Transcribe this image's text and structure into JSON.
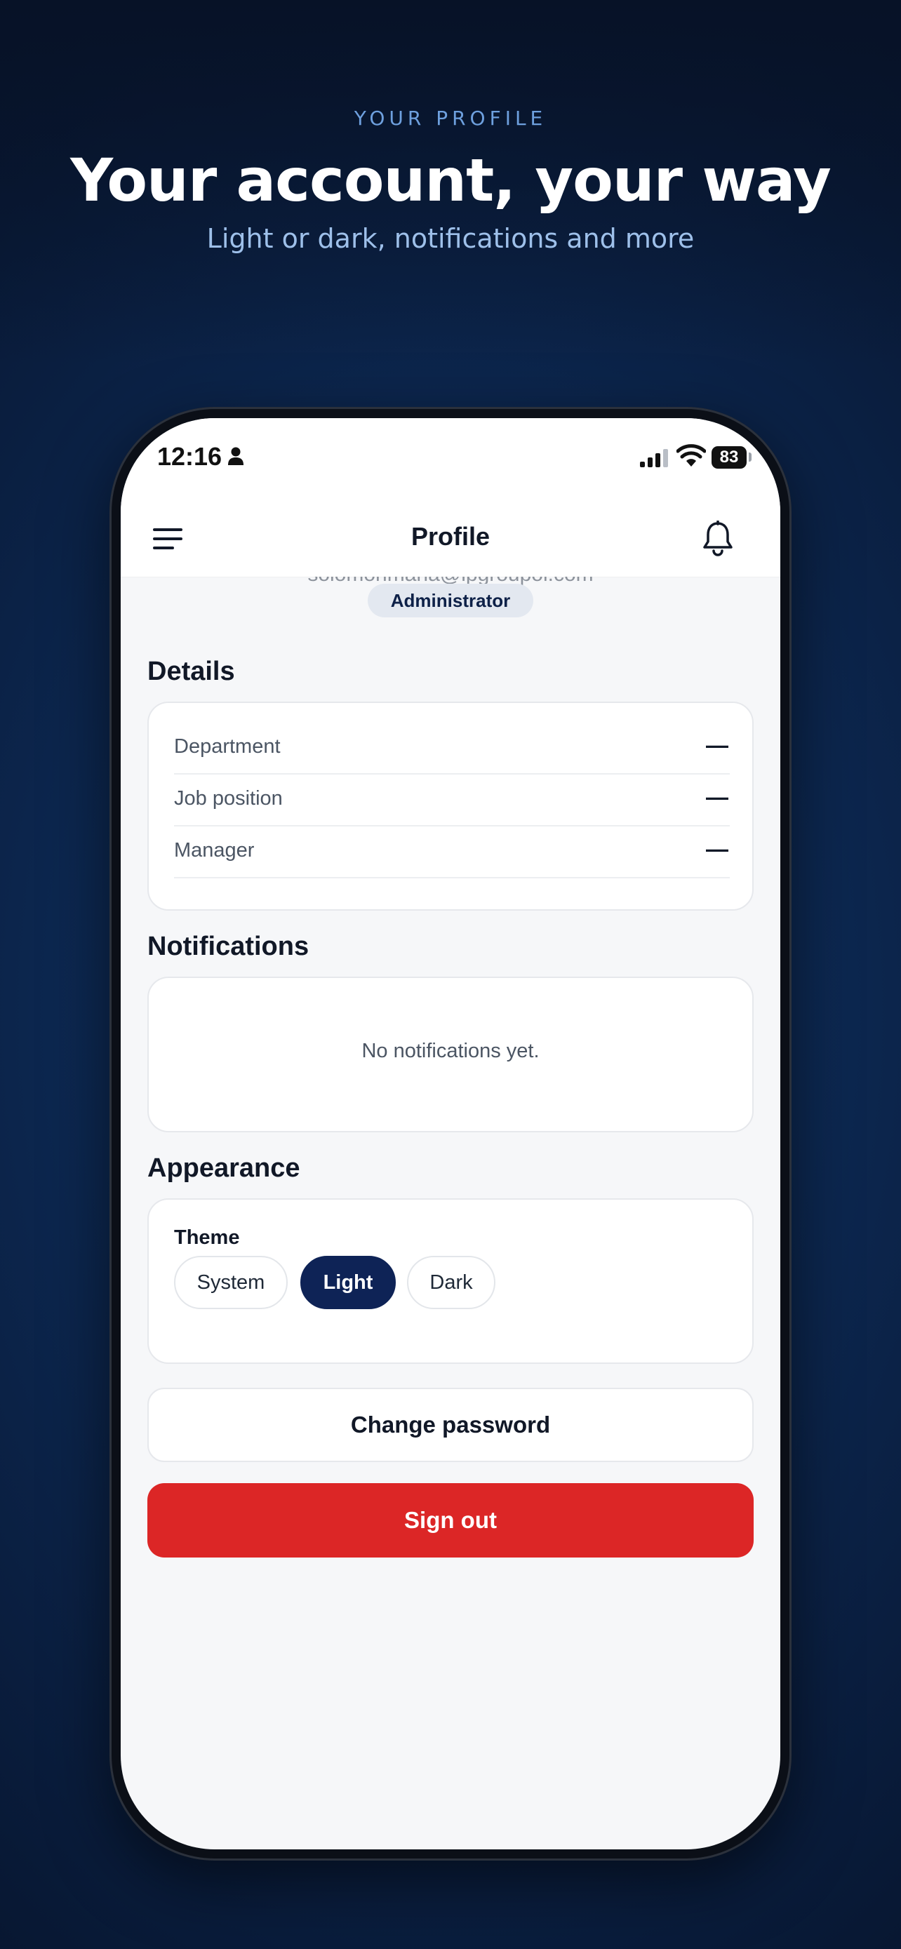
{
  "hero": {
    "eyebrow": "YOUR PROFILE",
    "title": "Your account, your way",
    "subtitle": "Light or dark, notifications and more"
  },
  "status_bar": {
    "time": "12:16",
    "battery": "83",
    "icons": [
      "person-icon",
      "cellular-signal-icon",
      "wifi-icon",
      "battery-icon"
    ]
  },
  "nav": {
    "title": "Profile",
    "left_icon": "hamburger-menu-icon",
    "right_icon": "bell-icon"
  },
  "profile": {
    "email_partial": "solomonmana@ipgroupoi.com",
    "role": "Administrator"
  },
  "details": {
    "title": "Details",
    "rows": [
      {
        "label": "Department",
        "value": "—"
      },
      {
        "label": "Job position",
        "value": "—"
      },
      {
        "label": "Manager",
        "value": "—"
      }
    ]
  },
  "notifications": {
    "title": "Notifications",
    "empty_text": "No notifications yet."
  },
  "appearance": {
    "title": "Appearance",
    "theme_label": "Theme",
    "options": [
      "System",
      "Light",
      "Dark"
    ],
    "selected": "Light"
  },
  "actions": {
    "change_password": "Change password",
    "sign_out": "Sign out"
  },
  "colors": {
    "accent_navy": "#0e2356",
    "danger_red": "#dc2626",
    "hero_eyebrow": "#6ea0de",
    "background": "#0d2a55"
  }
}
